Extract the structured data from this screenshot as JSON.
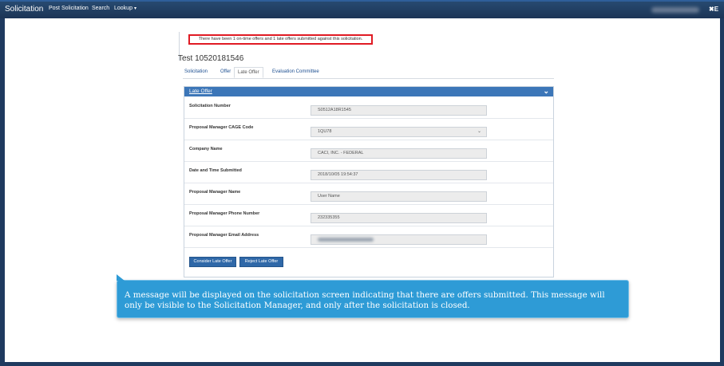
{
  "topbar": {
    "brand": "Solicitation",
    "nav": [
      "Post Solicitation",
      "Search",
      "Lookup"
    ],
    "close_glyph": "✖E"
  },
  "alert": {
    "text": "There have been 1 on-time offers and 1 late offers submitted against this solicitation.",
    "border_color": "#e01b24"
  },
  "solicitation": {
    "title": "Test 10520181546"
  },
  "tabs": [
    {
      "label": "Solicitation",
      "active": false
    },
    {
      "label": "Offer",
      "active": false
    },
    {
      "label": "Late Offer",
      "active": true
    },
    {
      "label": "Evaluation Committee",
      "active": false
    }
  ],
  "panel": {
    "title": "Late Offer",
    "fields": [
      {
        "label": "Solicitation Number",
        "value": "S0512A18R1545"
      },
      {
        "label": "Proposal Manager CAGE Code",
        "value": "1QU78"
      },
      {
        "label": "Company Name",
        "value": "CACI, INC. - FEDERAL"
      },
      {
        "label": "Date and Time Submitted",
        "value": "2018/10/05 19:54:37"
      },
      {
        "label": "Proposal Manager Name",
        "value": "User Name"
      },
      {
        "label": "Proposal Manager Phone Number",
        "value": "232335355"
      },
      {
        "label": "Proposal Manager Email Address",
        "value": ""
      }
    ],
    "buttons": {
      "consider": "Consider Late Offer",
      "reject": "Reject Late Offer"
    }
  },
  "callout": {
    "text": "A message will be displayed on the solicitation screen indicating that there are offers submitted. This message will only be visible to the Solicitation Manager, and only after the solicitation is closed."
  },
  "colors": {
    "header": "#1f3a5f",
    "panel_header": "#3c76b8",
    "button": "#2f68a8",
    "callout": "#2e9bd6"
  }
}
